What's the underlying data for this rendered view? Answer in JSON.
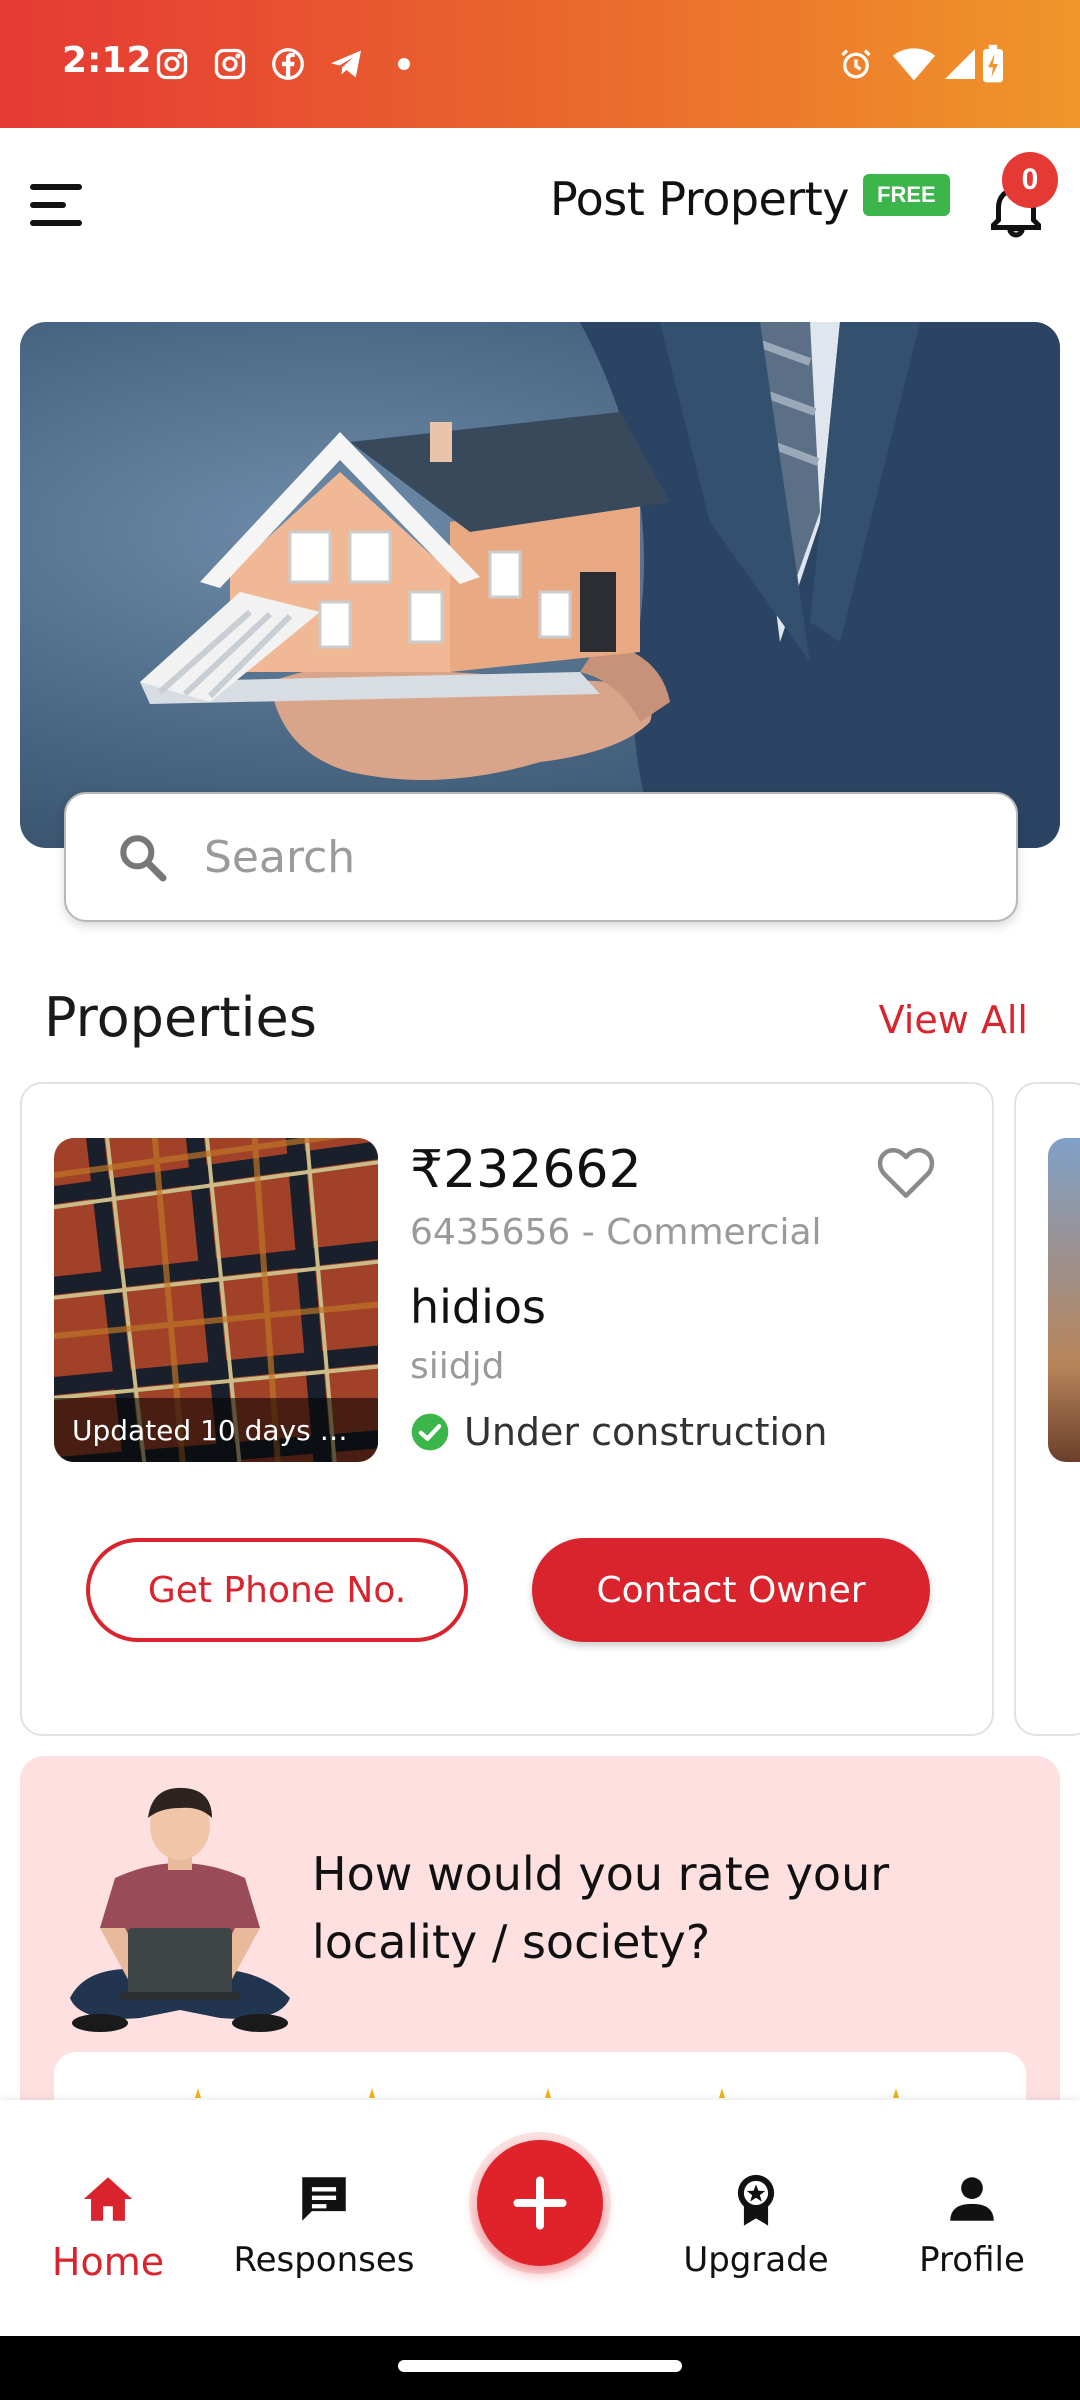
{
  "status_bar": {
    "time": "2:12",
    "left_icons": [
      "instagram-icon",
      "instagram-icon",
      "facebook-icon",
      "telegram-icon",
      "dot-icon"
    ],
    "right_icons": [
      "alarm-icon",
      "wifi-icon",
      "signal-icon",
      "battery-charging-icon"
    ]
  },
  "header": {
    "post_property_label": "Post Property",
    "free_badge": "FREE",
    "notification_count": "0"
  },
  "search": {
    "placeholder": "Search"
  },
  "properties": {
    "title": "Properties",
    "view_all": "View All",
    "items": [
      {
        "updated": "Updated 10 days a...",
        "price": "₹232662",
        "subline": "6435656 - Commercial",
        "name": "hidios",
        "sub": "siidjd",
        "status": "Under construction",
        "phone_button": "Get Phone No.",
        "contact_button": "Contact Owner"
      }
    ]
  },
  "rating": {
    "question": "How would you rate your locality / society?"
  },
  "bottom_nav": {
    "items": [
      {
        "label": "Home",
        "icon": "home-icon",
        "active": true
      },
      {
        "label": "Responses",
        "icon": "chat-icon",
        "active": false
      },
      {
        "label": "Upgrade",
        "icon": "badge-icon",
        "active": false
      },
      {
        "label": "Profile",
        "icon": "person-icon",
        "active": false
      }
    ],
    "fab_icon": "plus-icon"
  },
  "colors": {
    "accent": "#d9232d",
    "free_badge": "#3cb54a",
    "rating_bg": "#fde0df"
  }
}
